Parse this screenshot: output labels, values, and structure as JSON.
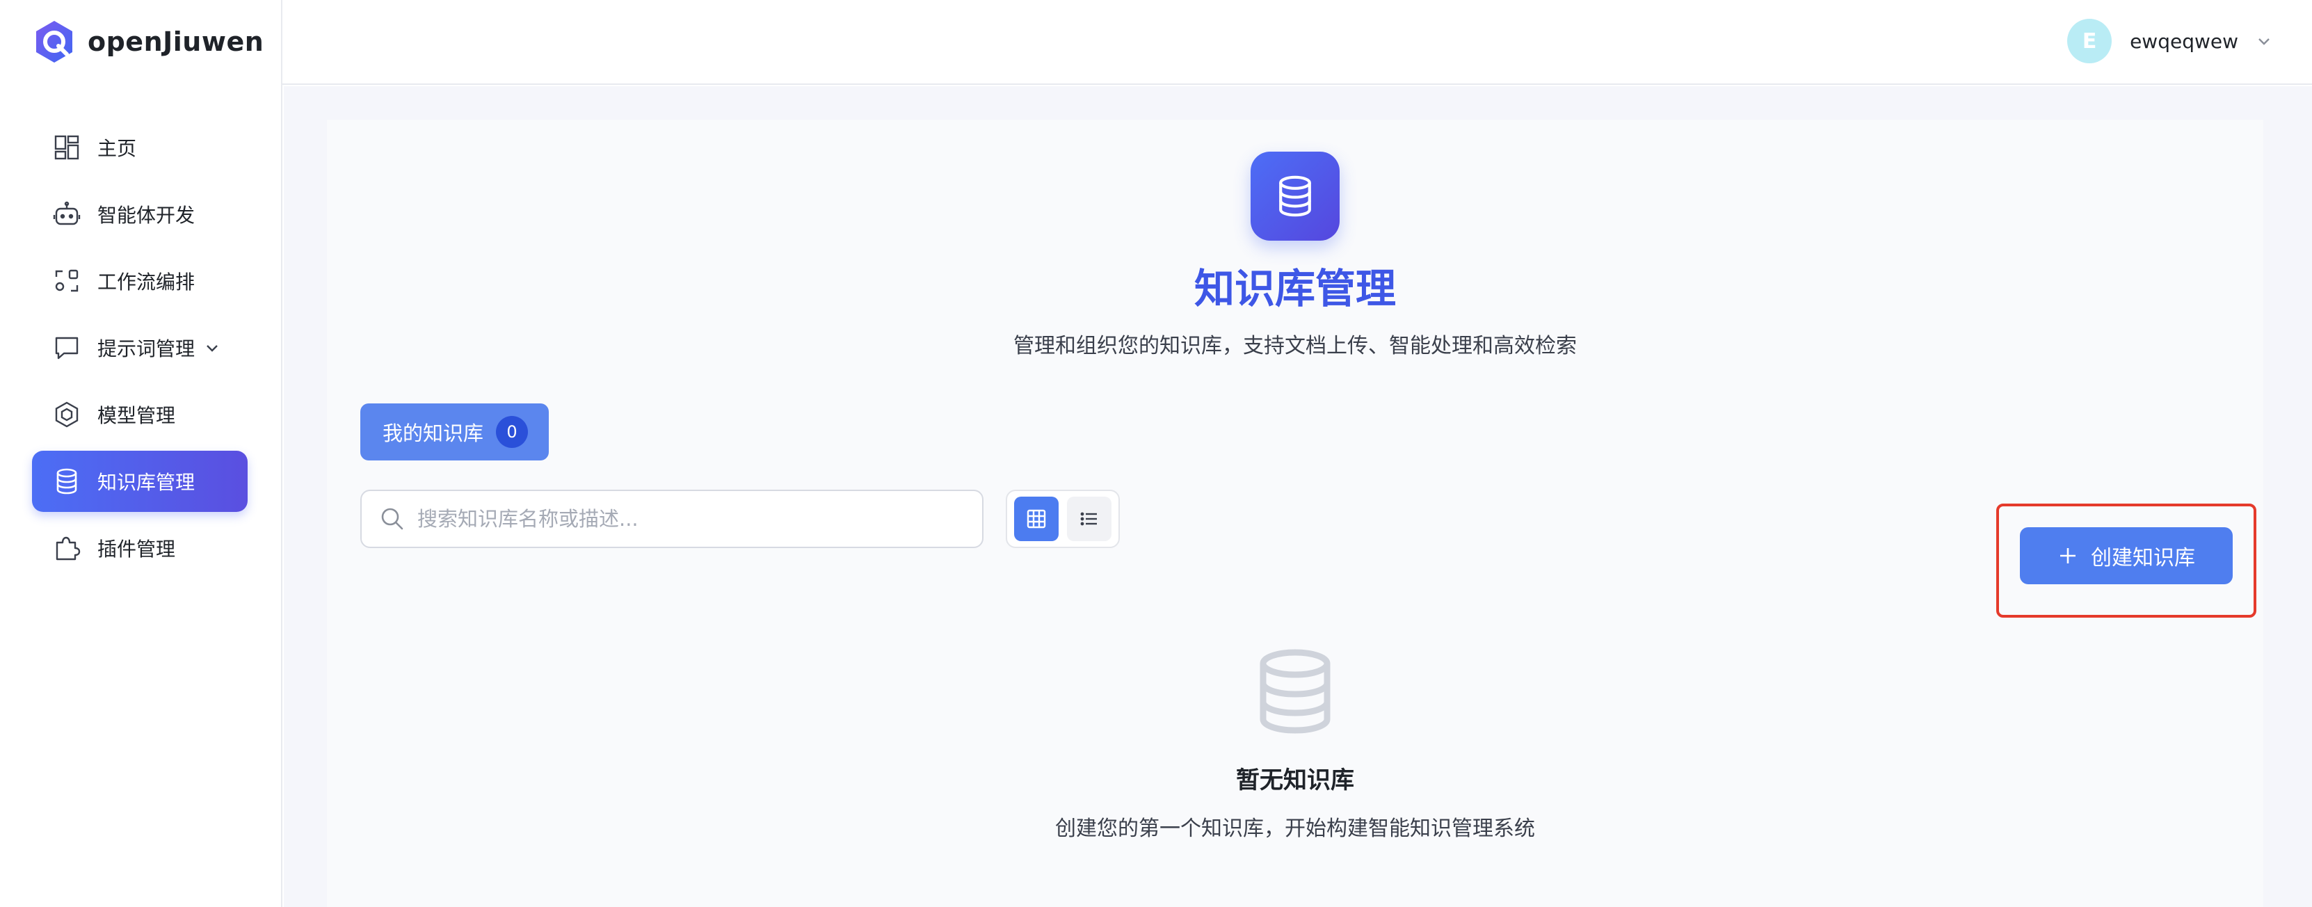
{
  "app": {
    "brand": "openJiuwen",
    "brand_color": "#4c5ee8"
  },
  "sidebar": {
    "items": [
      {
        "label": "主页",
        "icon": "dashboard-icon"
      },
      {
        "label": "智能体开发",
        "icon": "robot-icon"
      },
      {
        "label": "工作流编排",
        "icon": "workflow-icon"
      },
      {
        "label": "提示词管理",
        "icon": "message-icon"
      },
      {
        "label": "模型管理",
        "icon": "model-icon"
      },
      {
        "label": "知识库管理",
        "icon": "database-icon",
        "active": true
      },
      {
        "label": "插件管理",
        "icon": "puzzle-icon"
      }
    ]
  },
  "header": {
    "user_initial": "E",
    "username": "ewqeqwew"
  },
  "main": {
    "title": "知识库管理",
    "subtitle": "管理和组织您的知识库，支持文档上传、智能处理和高效检索",
    "tab_label": "我的知识库",
    "tab_count": "0",
    "search_placeholder": "搜索知识库名称或描述...",
    "search_value": "",
    "create_label": "创建知识库",
    "empty_title": "暂无知识库",
    "empty_subtitle": "创建您的第一个知识库，开始构建智能知识管理系统"
  },
  "colors": {
    "accent": "#4f7eef",
    "title": "#3e57e6",
    "highlight_border": "#e53a2b"
  }
}
